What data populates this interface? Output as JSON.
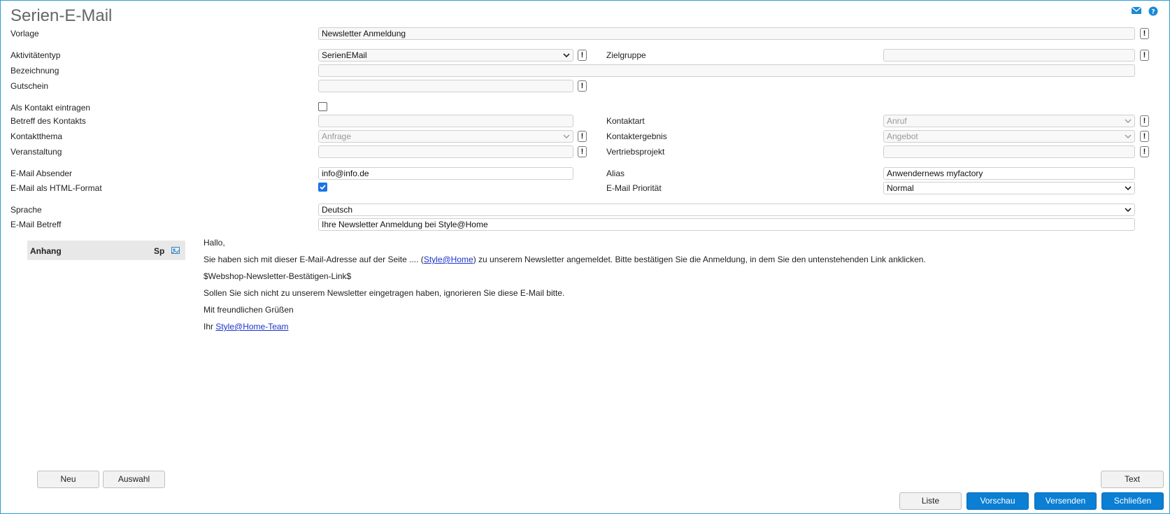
{
  "window": {
    "title": "Serien-E-Mail"
  },
  "icons": {
    "mail": "mail-icon",
    "help": "help-icon"
  },
  "form": {
    "vorlage": {
      "label": "Vorlage",
      "value": "Newsletter Anmeldung"
    },
    "aktivitaetentyp": {
      "label": "Aktivitätentyp",
      "value": "SerienEMail"
    },
    "zielgruppe": {
      "label": "Zielgruppe",
      "value": ""
    },
    "bezeichnung": {
      "label": "Bezeichnung",
      "value": ""
    },
    "gutschein": {
      "label": "Gutschein",
      "value": ""
    },
    "als_kontakt": {
      "label": "Als Kontakt eintragen",
      "checked": false
    },
    "betreff_kontakt": {
      "label": "Betreff des Kontakts",
      "value": ""
    },
    "kontaktart": {
      "label": "Kontaktart",
      "value": "Anruf"
    },
    "kontaktthema": {
      "label": "Kontaktthema",
      "value": "Anfrage"
    },
    "kontaktergebnis": {
      "label": "Kontaktergebnis",
      "value": "Angebot"
    },
    "veranstaltung": {
      "label": "Veranstaltung",
      "value": ""
    },
    "vertriebsprojekt": {
      "label": "Vertriebsprojekt",
      "value": ""
    },
    "absender": {
      "label": "E-Mail Absender",
      "value": "info@info.de"
    },
    "alias": {
      "label": "Alias",
      "value": "Anwendernews myfactory"
    },
    "html_format": {
      "label": "E-Mail als HTML-Format",
      "checked": true
    },
    "prioritaet": {
      "label": "E-Mail Priorität",
      "value": "Normal"
    },
    "sprache": {
      "label": "Sprache",
      "value": "Deutsch"
    },
    "betreff": {
      "label": "E-Mail Betreff",
      "value": "Ihre Newsletter Anmeldung bei Style@Home"
    }
  },
  "attachments": {
    "col_anhang": "Anhang",
    "col_sp": "Sp"
  },
  "email_body": {
    "greeting": "Hallo,",
    "line1_pre": "Sie haben sich mit dieser E-Mail-Adresse auf der Seite .... (",
    "line1_link": "Style@Home",
    "line1_post": ") zu unserem Newsletter angemeldet. Bitte bestätigen Sie die Anmeldung, in dem Sie den untenstehenden Link anklicken.",
    "placeholder": "$Webshop-Newsletter-Bestätigen-Link$",
    "line3": "Sollen Sie sich nicht zu unserem Newsletter eingetragen haben, ignorieren Sie diese E-Mail bitte.",
    "closing": "Mit freundlichen Grüßen",
    "sign_pre": "Ihr ",
    "sign_link": "Style@Home-Team"
  },
  "buttons": {
    "neu": "Neu",
    "auswahl": "Auswahl",
    "text": "Text",
    "liste": "Liste",
    "vorschau": "Vorschau",
    "versenden": "Versenden",
    "schliessen": "Schließen"
  },
  "colors": {
    "accent": "#0a7fd4",
    "border": "#2a9fd6"
  }
}
